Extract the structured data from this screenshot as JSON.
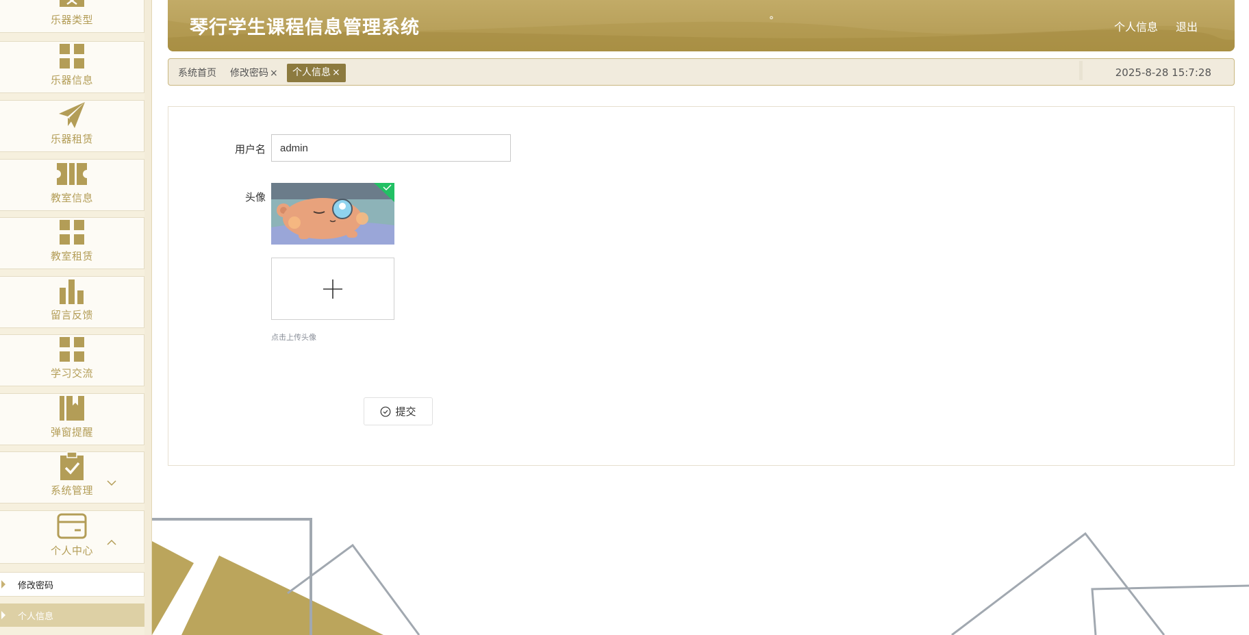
{
  "app": {
    "title": "琴行学生课程信息管理系统",
    "title_dot": "°"
  },
  "header": {
    "profile_link": "个人信息",
    "logout_link": "退出"
  },
  "sidebar": {
    "items": [
      {
        "label": "乐器类型",
        "icon": "image-icon"
      },
      {
        "label": "乐器信息",
        "icon": "grid-icon"
      },
      {
        "label": "乐器租赁",
        "icon": "paper-plane-icon"
      },
      {
        "label": "教室信息",
        "icon": "ticket-icon"
      },
      {
        "label": "教室租赁",
        "icon": "grid-icon"
      },
      {
        "label": "留言反馈",
        "icon": "bar-chart-icon"
      },
      {
        "label": "学习交流",
        "icon": "grid-icon"
      },
      {
        "label": "弹窗提醒",
        "icon": "book-icon"
      },
      {
        "label": "系统管理",
        "icon": "clipboard-check-icon"
      },
      {
        "label": "个人中心",
        "icon": "wallet-icon"
      }
    ],
    "sub_items": [
      {
        "label": "修改密码"
      },
      {
        "label": "个人信息"
      }
    ]
  },
  "tabs": [
    {
      "label": "系统首页"
    },
    {
      "label": "修改密码",
      "close": "×"
    },
    {
      "label": "个人信息",
      "close": "×",
      "active": true
    }
  ],
  "datetime": "2025-8-28 15:7:28",
  "form": {
    "username_label": "用户名",
    "username_value": "admin",
    "avatar_label": "头像",
    "upload_hint": "点击上传头像",
    "submit_label": "提交"
  },
  "colors": {
    "accent": "#b8a05a",
    "accent_dark": "#8c7a3f",
    "sidebar_text": "#b39d57",
    "tab_bg": "#f1ebdd"
  }
}
